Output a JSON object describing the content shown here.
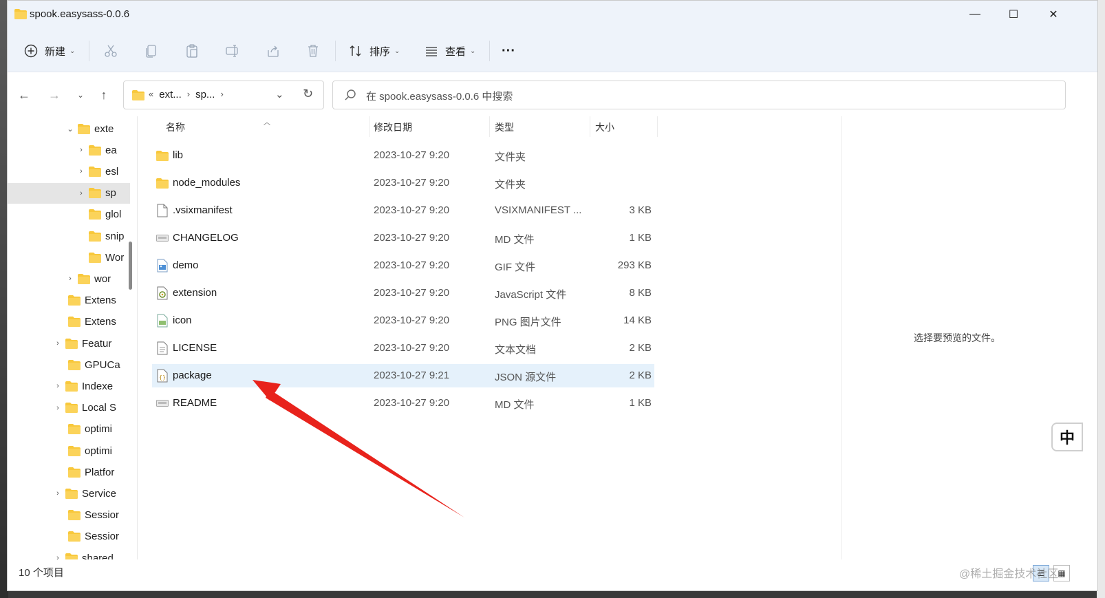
{
  "window": {
    "title": "spook.easysass-0.0.6",
    "minimize_glyph": "—",
    "maximize_glyph": "☐",
    "close_glyph": "✕"
  },
  "toolbar": {
    "new_label": "新建",
    "sort_label": "排序",
    "view_label": "查看",
    "more_label": "···",
    "icons": [
      "cut-icon",
      "copy-icon",
      "paste-icon",
      "rename-icon",
      "share-icon",
      "delete-icon"
    ]
  },
  "address": {
    "crumbs": [
      "ext...",
      "sp..."
    ],
    "overflow": "«",
    "search_placeholder": "在 spook.easysass-0.0.6 中搜索"
  },
  "tree": [
    {
      "label": "exte",
      "expanded": true
    },
    {
      "label": "ea"
    },
    {
      "label": "esl"
    },
    {
      "label": "sp",
      "selected": true
    },
    {
      "label": "glol"
    },
    {
      "label": "snip"
    },
    {
      "label": "Wor"
    },
    {
      "label": "wor"
    },
    {
      "label": "Extens"
    },
    {
      "label": "Extens"
    },
    {
      "label": "Featur"
    },
    {
      "label": "GPUCa"
    },
    {
      "label": "Indexe"
    },
    {
      "label": "Local S"
    },
    {
      "label": "optimi"
    },
    {
      "label": "optimi"
    },
    {
      "label": "Platfor"
    },
    {
      "label": "Service"
    },
    {
      "label": "Sessior"
    },
    {
      "label": "Sessior"
    },
    {
      "label": "shared"
    }
  ],
  "columns": {
    "name": "名称",
    "date": "修改日期",
    "type": "类型",
    "size": "大小"
  },
  "files": [
    {
      "name": "lib",
      "date": "2023-10-27 9:20",
      "type": "文件夹",
      "size": "",
      "icon": "folder-icon"
    },
    {
      "name": "node_modules",
      "date": "2023-10-27 9:20",
      "type": "文件夹",
      "size": "",
      "icon": "folder-icon"
    },
    {
      "name": ".vsixmanifest",
      "date": "2023-10-27 9:20",
      "type": "VSIXMANIFEST ...",
      "size": "3 KB",
      "icon": "file-icon"
    },
    {
      "name": "CHANGELOG",
      "date": "2023-10-27 9:20",
      "type": "MD 文件",
      "size": "1 KB",
      "icon": "md-file-icon"
    },
    {
      "name": "demo",
      "date": "2023-10-27 9:20",
      "type": "GIF 文件",
      "size": "293 KB",
      "icon": "image-file-icon"
    },
    {
      "name": "extension",
      "date": "2023-10-27 9:20",
      "type": "JavaScript 文件",
      "size": "8 KB",
      "icon": "js-file-icon"
    },
    {
      "name": "icon",
      "date": "2023-10-27 9:20",
      "type": "PNG 图片文件",
      "size": "14 KB",
      "icon": "png-file-icon"
    },
    {
      "name": "LICENSE",
      "date": "2023-10-27 9:20",
      "type": "文本文档",
      "size": "2 KB",
      "icon": "text-file-icon"
    },
    {
      "name": "package",
      "date": "2023-10-27 9:21",
      "type": "JSON 源文件",
      "size": "2 KB",
      "icon": "json-file-icon",
      "selected": true
    },
    {
      "name": "README",
      "date": "2023-10-27 9:20",
      "type": "MD 文件",
      "size": "1 KB",
      "icon": "md-file-icon"
    }
  ],
  "preview": {
    "empty_text": "选择要预览的文件。"
  },
  "status": {
    "item_count": "10 个项目"
  },
  "ime": {
    "label": "中"
  },
  "watermark": "@稀土掘金技术社区",
  "colors": {
    "accent": "#0067c0",
    "selection": "#e5f1fb",
    "folder": "#f8c83c",
    "annotation_arrow": "#e8231c",
    "chrome": "#eef3fa"
  }
}
